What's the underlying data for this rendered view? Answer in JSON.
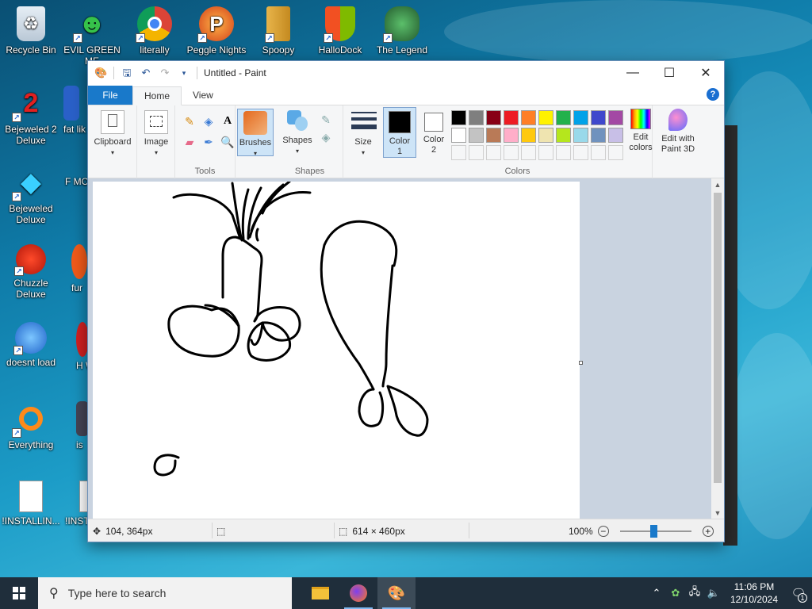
{
  "desktop": {
    "icons": [
      {
        "label": "Recycle Bin",
        "glyph": "recycle-bin-icon"
      },
      {
        "label": "EVIL GREEN ME",
        "glyph": "messenger-icon"
      },
      {
        "label": "literally",
        "glyph": "chrome-icon"
      },
      {
        "label": "Peggle Nights",
        "glyph": "peggle-icon"
      },
      {
        "label": "Spoopy",
        "glyph": "folder-archive-icon"
      },
      {
        "label": "HalloDock",
        "glyph": "windows-shield-icon"
      },
      {
        "label": "The Legend",
        "glyph": "game-character-icon"
      },
      {
        "label": "Bejeweled 2 Deluxe",
        "glyph": "bejeweled2-icon"
      },
      {
        "label": "fat lik",
        "glyph": "app-icon"
      },
      {
        "label": "Bejeweled Deluxe",
        "glyph": "bejeweled-icon"
      },
      {
        "label": "F MON",
        "glyph": "app-icon"
      },
      {
        "label": "Chuzzle Deluxe",
        "glyph": "chuzzle-icon"
      },
      {
        "label": "fur",
        "glyph": "app-icon"
      },
      {
        "label": "doesnt load",
        "glyph": "thunderbird-icon"
      },
      {
        "label": "H W",
        "glyph": "app-icon"
      },
      {
        "label": "Everything",
        "glyph": "everything-search-icon"
      },
      {
        "label": "is",
        "glyph": "app-icon"
      },
      {
        "label": "!INSTALLIN...",
        "glyph": "text-file-icon"
      },
      {
        "label": "!INST - Sh",
        "glyph": "text-file-icon"
      }
    ]
  },
  "paint": {
    "title": "Untitled - Paint",
    "tabs": {
      "file": "File",
      "home": "Home",
      "view": "View"
    },
    "groups": {
      "clipboard": "Clipboard",
      "image": "Image",
      "tools": "Tools",
      "brushes": "Brushes",
      "shapes_btn": "Shapes",
      "shapes": "Shapes",
      "size": "Size",
      "color1": "Color 1",
      "color2": "Color 2",
      "colors": "Colors",
      "edit_colors": "Edit colors",
      "edit_paint3d": "Edit with Paint 3D"
    },
    "palette": {
      "row1": [
        "#000000",
        "#7f7f7f",
        "#880015",
        "#ed1c24",
        "#ff7f27",
        "#fff200",
        "#22b14c",
        "#00a2e8",
        "#3f48cc",
        "#a349a4"
      ],
      "row2": [
        "#ffffff",
        "#c3c3c3",
        "#b97a57",
        "#ffaec9",
        "#ffc90e",
        "#efe4b0",
        "#b5e61d",
        "#99d9ea",
        "#7092be",
        "#c8bfe7"
      ],
      "color1": "#000000",
      "color2": "#ffffff"
    },
    "status": {
      "cursor": "104, 364px",
      "selection": "",
      "canvas_size": "614 × 460px",
      "zoom": "100%"
    }
  },
  "taskbar": {
    "search_placeholder": "Type here to search",
    "time": "11:06 PM",
    "date": "12/10/2024",
    "notifications": "1"
  }
}
